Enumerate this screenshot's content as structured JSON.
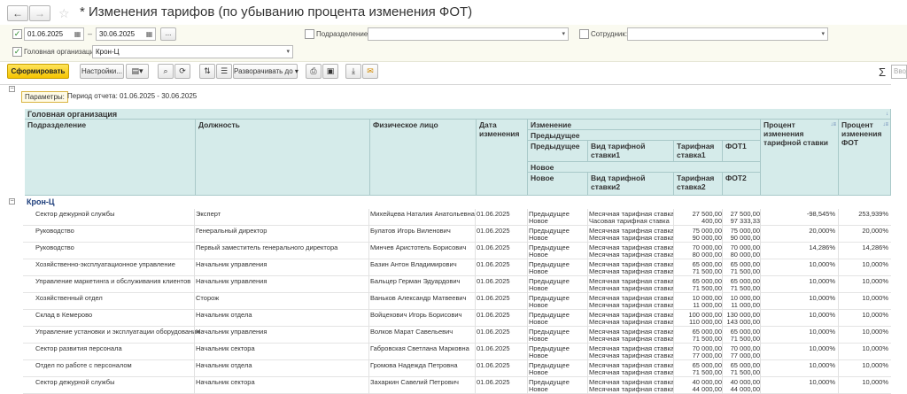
{
  "title": "* Изменения тарифов (по убыванию процента изменения ФОТ)",
  "nav": {
    "back": "←",
    "forward": "→",
    "star": "☆"
  },
  "filters": {
    "date_from": "01.06.2025",
    "date_sep": "–",
    "date_to": "30.06.2025",
    "dots": "...",
    "department_label": "Подразделение:",
    "department_value": "",
    "employee_label": "Сотрудник:",
    "employee_value": "",
    "org_label": "Головная организация:",
    "org_value": "Крон-Ц"
  },
  "toolbar": {
    "generate": "Сформировать",
    "settings": "Настройки...",
    "expand": "Разворачивать до",
    "sigma": "Σ",
    "search_placeholder": "Ввод"
  },
  "report": {
    "params_label": "Параметры:",
    "period": "Период отчета: 01.06.2025 - 30.06.2025",
    "head_org": "Головная организация",
    "columns": {
      "department": "Подразделение",
      "position": "Должность",
      "person": "Физическое лицо",
      "date": "Дата изменения",
      "change": "Изменение",
      "previous_group": "Предыдущее",
      "previous": "Предыдущее",
      "rate_type1": "Вид тарифной ставки1",
      "rate1": "Тарифная ставка1",
      "fot1": "ФОТ1",
      "new_group": "Новое",
      "new": "Новое",
      "rate_type2": "Вид тарифной ставки2",
      "rate2": "Тарифная ставка2",
      "fot2": "ФОТ2",
      "pct_rate": "Процент изменения тарифной ставки",
      "pct_fot": "Процент изменения ФОТ"
    },
    "group": "Крон-Ц",
    "rows": [
      {
        "dept": "Сектор дежурной службы",
        "pos": "Эксперт",
        "person": "Михейцева Наталия Анатольевна",
        "date": "01.06.2025",
        "k1": "Предыдущее",
        "k2": "Новое",
        "t1": "Месячная тарифная ставка",
        "t2": "Часовая тарифная ставка",
        "r1": "27 500,00",
        "r2": "400,00",
        "f1": "27 500,00",
        "f2": "97 333,33",
        "p1": "-98,545%",
        "p2": "253,939%"
      },
      {
        "dept": "Руководство",
        "pos": "Генеральный директор",
        "person": "Булатов Игорь Виленович",
        "date": "01.06.2025",
        "k1": "Предыдущее",
        "k2": "Новое",
        "t1": "Месячная тарифная ставка",
        "t2": "Месячная тарифная ставка",
        "r1": "75 000,00",
        "r2": "90 000,00",
        "f1": "75 000,00",
        "f2": "90 000,00",
        "p1": "20,000%",
        "p2": "20,000%"
      },
      {
        "dept": "Руководство",
        "pos": "Первый заместитель генерального директора",
        "person": "Минчев Аристотель Борисович",
        "date": "01.06.2025",
        "k1": "Предыдущее",
        "k2": "Новое",
        "t1": "Месячная тарифная ставка",
        "t2": "Месячная тарифная ставка",
        "r1": "70 000,00",
        "r2": "80 000,00",
        "f1": "70 000,00",
        "f2": "80 000,00",
        "p1": "14,286%",
        "p2": "14,286%"
      },
      {
        "dept": "Хозяйственно-эксплуатационное управление",
        "pos": "Начальник управления",
        "person": "Базин Антон Владимирович",
        "date": "01.06.2025",
        "k1": "Предыдущее",
        "k2": "Новое",
        "t1": "Месячная тарифная ставка",
        "t2": "Месячная тарифная ставка",
        "r1": "65 000,00",
        "r2": "71 500,00",
        "f1": "65 000,00",
        "f2": "71 500,00",
        "p1": "10,000%",
        "p2": "10,000%"
      },
      {
        "dept": "Управление маркетинга и обслуживания клиентов",
        "pos": "Начальник управления",
        "person": "Бальцер Герман Эдуардович",
        "date": "01.06.2025",
        "k1": "Предыдущее",
        "k2": "Новое",
        "t1": "Месячная тарифная ставка",
        "t2": "Месячная тарифная ставка",
        "r1": "65 000,00",
        "r2": "71 500,00",
        "f1": "65 000,00",
        "f2": "71 500,00",
        "p1": "10,000%",
        "p2": "10,000%"
      },
      {
        "dept": "Хозяйственный отдел",
        "pos": "Сторож",
        "person": "Ваньков Александр Матвеевич",
        "date": "01.06.2025",
        "k1": "Предыдущее",
        "k2": "Новое",
        "t1": "Месячная тарифная ставка",
        "t2": "Месячная тарифная ставка",
        "r1": "10 000,00",
        "r2": "11 000,00",
        "f1": "10 000,00",
        "f2": "11 000,00",
        "p1": "10,000%",
        "p2": "10,000%"
      },
      {
        "dept": "Склад в Кемерово",
        "pos": "Начальник отдела",
        "person": "Войцехович Игорь Борисович",
        "date": "01.06.2025",
        "k1": "Предыдущее",
        "k2": "Новое",
        "t1": "Месячная тарифная ставка",
        "t2": "Месячная тарифная ставка",
        "r1": "100 000,00",
        "r2": "110 000,00",
        "f1": "130 000,00",
        "f2": "143 000,00",
        "p1": "10,000%",
        "p2": "10,000%"
      },
      {
        "dept": "Управление установки и эксплуатации оборудования",
        "pos": "Начальник управления",
        "person": "Волков Марат Савельевич",
        "date": "01.06.2025",
        "k1": "Предыдущее",
        "k2": "Новое",
        "t1": "Месячная тарифная ставка",
        "t2": "Месячная тарифная ставка",
        "r1": "65 000,00",
        "r2": "71 500,00",
        "f1": "65 000,00",
        "f2": "71 500,00",
        "p1": "10,000%",
        "p2": "10,000%"
      },
      {
        "dept": "Сектор развития персонала",
        "pos": "Начальник сектора",
        "person": "Габровская Светлана Марковна",
        "date": "01.06.2025",
        "k1": "Предыдущее",
        "k2": "Новое",
        "t1": "Месячная тарифная ставка",
        "t2": "Месячная тарифная ставка",
        "r1": "70 000,00",
        "r2": "77 000,00",
        "f1": "70 000,00",
        "f2": "77 000,00",
        "p1": "10,000%",
        "p2": "10,000%"
      },
      {
        "dept": "Отдел по работе с персоналом",
        "pos": "Начальник отдела",
        "person": "Громова Надежда Петровна",
        "date": "01.06.2025",
        "k1": "Предыдущее",
        "k2": "Новое",
        "t1": "Месячная тарифная ставка",
        "t2": "Месячная тарифная ставка",
        "r1": "65 000,00",
        "r2": "71 500,00",
        "f1": "65 000,00",
        "f2": "71 500,00",
        "p1": "10,000%",
        "p2": "10,000%"
      },
      {
        "dept": "Сектор дежурной службы",
        "pos": "Начальник сектора",
        "person": "Захаркин Савелий Петрович",
        "date": "01.06.2025",
        "k1": "Предыдущее",
        "k2": "Новое",
        "t1": "Месячная тарифная ставка",
        "t2": "Месячная тарифная ставка",
        "r1": "40 000,00",
        "r2": "44 000,00",
        "f1": "40 000,00",
        "f2": "44 000,00",
        "p1": "10,000%",
        "p2": "10,000%"
      }
    ]
  }
}
